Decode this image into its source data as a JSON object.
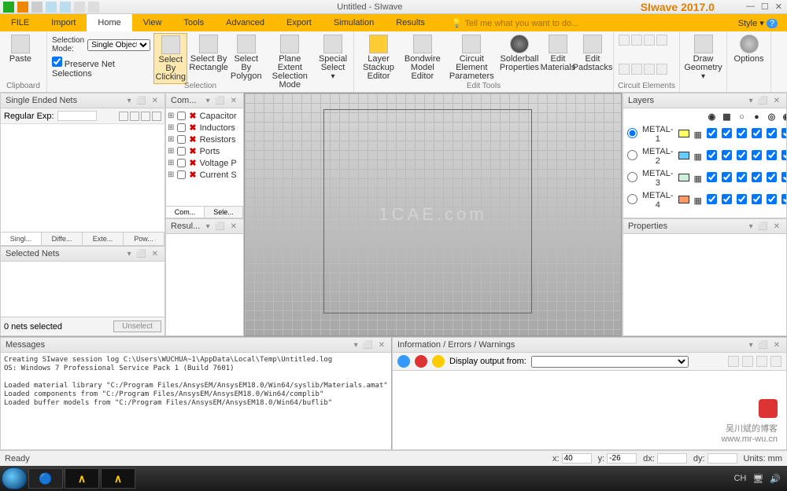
{
  "title": "Untitled - SIwave",
  "brand": "SIwave 2017.0",
  "menu": {
    "file": "FILE",
    "import": "Import",
    "home": "Home",
    "view": "View",
    "tools": "Tools",
    "advanced": "Advanced",
    "export": "Export",
    "simulation": "Simulation",
    "results": "Results",
    "tell": "Tell me what you want to do...",
    "style": "Style"
  },
  "ribbon": {
    "clipboard": {
      "label": "Clipboard",
      "paste": "Paste"
    },
    "selection": {
      "label": "Selection",
      "mode_label": "Selection Mode:",
      "mode_value": "Single Object",
      "preserve": "Preserve Net Selections",
      "byclick": "Select By Clicking",
      "byrect": "Select By Rectangle",
      "bypoly": "Select By Polygon",
      "plane": "Plane Extent Selection Mode",
      "special": "Special Select"
    },
    "edittools": {
      "label": "Edit Tools",
      "stackup": "Layer Stackup Editor",
      "bondwire": "Bondwire Model Editor",
      "circuit": "Circuit Element Parameters",
      "solder": "Solderball Properties",
      "mat": "Edit Materials",
      "pad": "Edit Padstacks"
    },
    "circelem": {
      "label": "Circuit Elements"
    },
    "draw": {
      "label": "",
      "geom": "Draw Geometry"
    },
    "options": {
      "label": "",
      "opt": "Options"
    }
  },
  "sen": {
    "title": "Single Ended Nets",
    "reg_label": "Regular Exp:",
    "reg_val": "",
    "tabs": [
      "Singl...",
      "Diffe...",
      "Exte...",
      "Pow..."
    ]
  },
  "selnets": {
    "title": "Selected Nets",
    "count": "0 nets selected",
    "unselect": "Unselect"
  },
  "comp": {
    "title": "Com...",
    "items": [
      "Capacitor",
      "Inductors",
      "Resistors",
      "Ports",
      "Voltage P",
      "Current S"
    ],
    "tabs": [
      "Com...",
      "Sele..."
    ]
  },
  "res": {
    "title": "Resul..."
  },
  "layers": {
    "title": "Layers",
    "rows": [
      {
        "name": "METAL-1",
        "c": "#ffff66"
      },
      {
        "name": "METAL-2",
        "c": "#66ccff"
      },
      {
        "name": "METAL-3",
        "c": "#cceedd"
      },
      {
        "name": "METAL-4",
        "c": "#ff9966"
      }
    ]
  },
  "props": {
    "title": "Properties"
  },
  "msgs": {
    "title": "Messages",
    "text": "Creating SIwave session log C:\\Users\\WUCHUA~1\\AppData\\Local\\Temp\\Untitled.log\nOS: Windows 7 Professional Service Pack 1 (Build 7601)\n\nLoaded material library \"C:/Program Files/AnsysEM/AnsysEM18.0/Win64/syslib/Materials.amat\"\nLoaded components from \"C:/Program Files/AnsysEM/AnsysEM18.0/Win64/complib\"\nLoaded buffer models from \"C:/Program Files/AnsysEM/AnsysEM18.0/Win64/buflib\""
  },
  "info": {
    "title": "Information / Errors / Warnings",
    "out_label": "Display output from:",
    "out_val": ""
  },
  "status": {
    "ready": "Ready",
    "x_l": "x:",
    "x_v": "40",
    "y_l": "y:",
    "y_v": "-26",
    "dx_l": "dx:",
    "dx_v": "",
    "dy_l": "dy:",
    "dy_v": "",
    "units_l": "Units:",
    "units_v": "mm"
  },
  "taskbar": {
    "lang": "CH"
  },
  "badge": {
    "line1": "吴川斌的博客",
    "line2": "www.mr-wu.cn"
  },
  "watermark": "1CAE.com"
}
